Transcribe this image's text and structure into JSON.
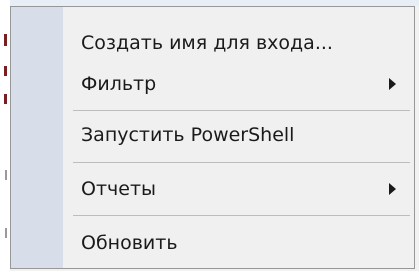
{
  "context_menu": {
    "items": [
      {
        "label": "Создать имя для входа...",
        "has_submenu": false
      },
      {
        "label": "Фильтр",
        "has_submenu": true
      },
      {
        "label": "Запустить PowerShell",
        "has_submenu": false
      },
      {
        "label": "Отчеты",
        "has_submenu": true
      },
      {
        "label": "Обновить",
        "has_submenu": false
      }
    ],
    "icons": {
      "submenu": "chevron-right-icon"
    }
  }
}
